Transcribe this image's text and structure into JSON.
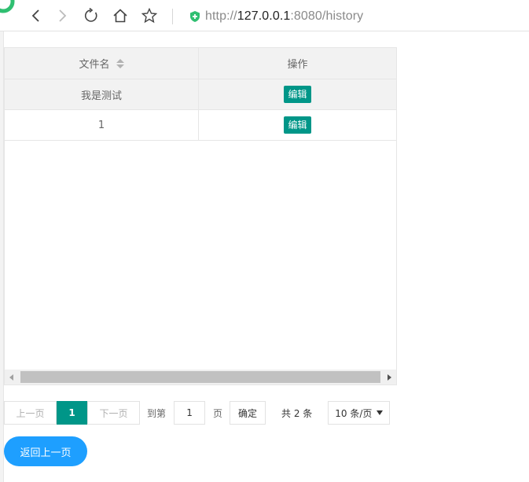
{
  "browser": {
    "url_scheme": "http://",
    "url_host": "127.0.0.1",
    "url_rest": ":8080/history",
    "icons": [
      "back-icon",
      "forward-icon",
      "reload-icon",
      "home-icon",
      "bookmark-star-icon",
      "secure-shield-icon"
    ]
  },
  "table": {
    "headers": {
      "filename": "文件名",
      "actions": "操作"
    },
    "rows": [
      {
        "filename": "我是测试",
        "action_label": "编辑"
      },
      {
        "filename": "1",
        "action_label": "编辑"
      }
    ]
  },
  "pager": {
    "prev_label": "上一页",
    "current_page": "1",
    "next_label": "下一页",
    "goto_prefix": "到第",
    "goto_value": "1",
    "goto_suffix": "页",
    "confirm_label": "确定",
    "total_label": "共 2 条",
    "page_size_label": "10 条/页"
  },
  "back_button_label": "返回上一页",
  "colors": {
    "primary": "#009688",
    "blue": "#1e9fff",
    "secure": "#2fbf71"
  }
}
